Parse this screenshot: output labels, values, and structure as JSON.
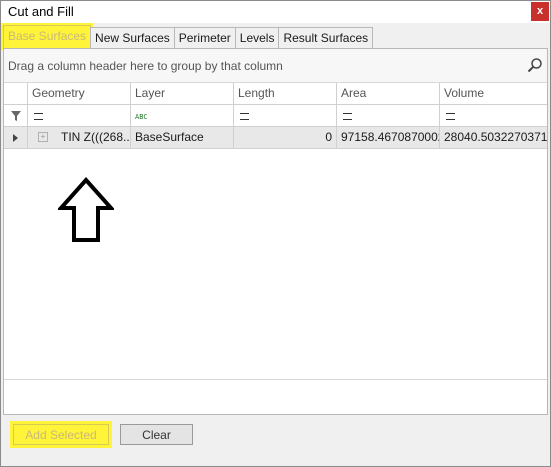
{
  "window": {
    "title": "Cut and Fill",
    "close_label": "x"
  },
  "tabs": [
    {
      "label": "Base Surfaces",
      "active": true
    },
    {
      "label": "New Surfaces",
      "active": false
    },
    {
      "label": "Perimeter",
      "active": false
    },
    {
      "label": "Levels",
      "active": false
    },
    {
      "label": "Result Surfaces",
      "active": false
    }
  ],
  "grid": {
    "group_hint": "Drag a column header here to group by that column",
    "columns": [
      "Geometry",
      "Layer",
      "Length",
      "Area",
      "Volume"
    ],
    "filter_layer_icon_text": "ABC",
    "rows": [
      {
        "geometry": "TIN Z(((268...",
        "layer": "BaseSurface",
        "length": "0",
        "area": "97158.4670870002",
        "volume": "28040.5032270371"
      }
    ]
  },
  "footer": {
    "add_selected_label": "Add Selected",
    "clear_label": "Clear"
  },
  "colors": {
    "highlight": "#fff43a",
    "close": "#c9302c"
  },
  "icons": {
    "search": "search-icon",
    "filter": "filter-icon",
    "row_expand": "expand-arrow-icon",
    "up_arrow": "up-arrow-icon"
  }
}
